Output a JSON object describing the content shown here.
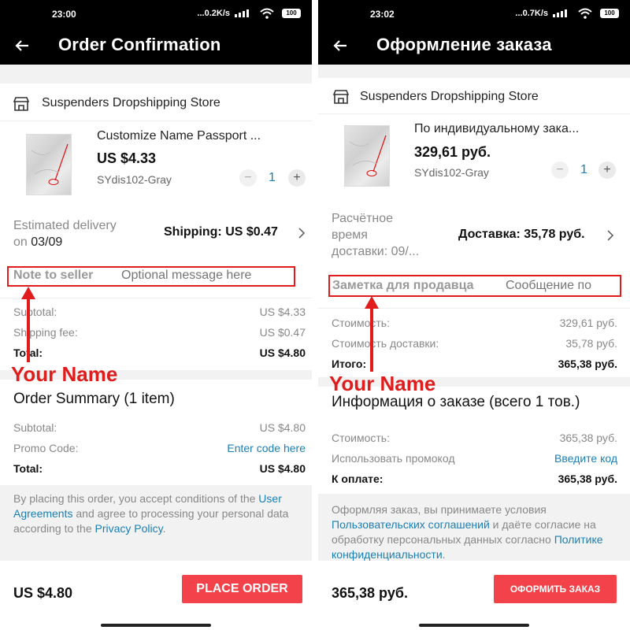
{
  "colors": {
    "accent": "#f4424a",
    "link": "#1a7fb5",
    "annotation": "#e01c1c",
    "appbar": "#000000"
  },
  "left": {
    "status": {
      "time": "23:00",
      "network": "...0.2K/s",
      "battery": "100"
    },
    "title": "Order Confirmation",
    "store": {
      "name": "Suspenders Dropshipping Store",
      "icon": "store-icon"
    },
    "product": {
      "title": "Customize Name Passport ...",
      "price": "US $4.33",
      "sku": "SYdis102-Gray",
      "quantity": "1"
    },
    "delivery": {
      "label": "Estimated delivery",
      "date_prefix": "on",
      "date": "03/09",
      "shipping": "Shipping: US $0.47"
    },
    "note": {
      "label": "Note to seller",
      "placeholder": "Optional message here"
    },
    "totals": [
      {
        "label": "Subtotal:",
        "value": "US $4.33"
      },
      {
        "label": "Shipping fee:",
        "value": "US $0.47"
      },
      {
        "label": "Total:",
        "value": "US $4.80"
      }
    ],
    "annotation": "Your Name",
    "summary": {
      "title": "Order Summary (1 item)",
      "subtotal_label": "Subtotal:",
      "subtotal_value": "US $4.80",
      "promo_label": "Promo Code:",
      "promo_link": "Enter code here",
      "total_label": "Total:",
      "total_value": "US $4.80"
    },
    "terms": {
      "t1": "By placing this order, you accept conditions of the",
      "link1": "User Agreements",
      "t2": "and agree to processing your personal data according to the",
      "link2": "Privacy Policy",
      "t3": "."
    },
    "footer": {
      "total": "US $4.80",
      "button": "PLACE ORDER"
    }
  },
  "right": {
    "status": {
      "time": "23:02",
      "network": "...0.7K/s",
      "battery": "100"
    },
    "title": "Оформление заказа",
    "store": {
      "name": "Suspenders Dropshipping Store",
      "icon": "store-icon"
    },
    "product": {
      "title": "По индивидуальному зака...",
      "price": "329,61 руб.",
      "sku": "SYdis102-Gray",
      "quantity": "1"
    },
    "delivery": {
      "line1": "Расчётное",
      "line2": "время",
      "line3": "доставки: 09/...",
      "shipping": "Доставка: 35,78 руб."
    },
    "note": {
      "label": "Заметка для продавца",
      "placeholder": "Сообщение по"
    },
    "totals": [
      {
        "label": "Стоимость:",
        "value": "329,61 руб."
      },
      {
        "label": "Стоимость доставки:",
        "value": "35,78 руб."
      },
      {
        "label": "Итого:",
        "value": "365,38 руб."
      }
    ],
    "annotation": "Your Name",
    "summary": {
      "title": "Информация о заказе (всего 1 тов.)",
      "subtotal_label": "Стоимость:",
      "subtotal_value": "365,38 руб.",
      "promo_label": "Использовать промокод",
      "promo_link": "Введите код",
      "total_label": "К оплате:",
      "total_value": "365,38 руб."
    },
    "terms": {
      "t1": "Оформляя заказ, вы принимаете условия",
      "link1": "Пользовательских соглашений",
      "t2": "и даёте согласие на обработку персональных данных согласно",
      "link2": "Политике конфиденциальности",
      "t3": "."
    },
    "footer": {
      "total": "365,38 руб.",
      "button": "ОФОРМИТЬ ЗАКАЗ"
    }
  }
}
